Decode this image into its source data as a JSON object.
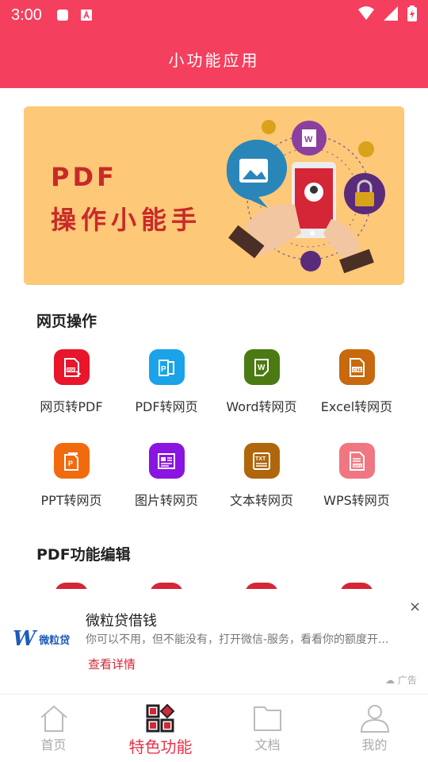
{
  "status_bar": {
    "time": "3:00"
  },
  "app_bar": {
    "title": "小功能应用"
  },
  "banner": {
    "line1": "PDF",
    "line2": "操作小能手"
  },
  "sections": [
    {
      "title": "网页操作",
      "items": [
        {
          "label": "网页转PDF",
          "color": "#e8152b",
          "icon": "pdf-file-icon"
        },
        {
          "label": "PDF转网页",
          "color": "#1aa3e8",
          "icon": "pdf-doc-icon"
        },
        {
          "label": "Word转网页",
          "color": "#4c7a12",
          "icon": "word-doc-icon"
        },
        {
          "label": "Excel转网页",
          "color": "#c8690d",
          "icon": "excel-doc-icon"
        },
        {
          "label": "PPT转网页",
          "color": "#f26a0e",
          "icon": "ppt-doc-icon"
        },
        {
          "label": "图片转网页",
          "color": "#8a14e0",
          "icon": "image-doc-icon"
        },
        {
          "label": "文本转网页",
          "color": "#b0660b",
          "icon": "txt-doc-icon"
        },
        {
          "label": "WPS转网页",
          "color": "#f07682",
          "icon": "wps-doc-icon"
        }
      ]
    },
    {
      "title": "PDF功能编辑"
    }
  ],
  "ad": {
    "brand": "微粒贷",
    "title": "微粒贷借钱",
    "description": "你可以不用，但不能没有，打开微信-服务，看看你的额度开...",
    "link": "查看详情",
    "close": "×",
    "tag": "广告"
  },
  "tabbar": {
    "items": [
      {
        "label": "首页",
        "icon": "home-icon",
        "active": false
      },
      {
        "label": "特色功能",
        "icon": "feature-grid-icon",
        "active": true
      },
      {
        "label": "文档",
        "icon": "folder-icon",
        "active": false
      },
      {
        "label": "我的",
        "icon": "person-icon",
        "active": false
      }
    ]
  },
  "colors": {
    "accent": "#f43f5e",
    "banner_bg": "#fdc878",
    "banner_text": "#c82a2a"
  }
}
